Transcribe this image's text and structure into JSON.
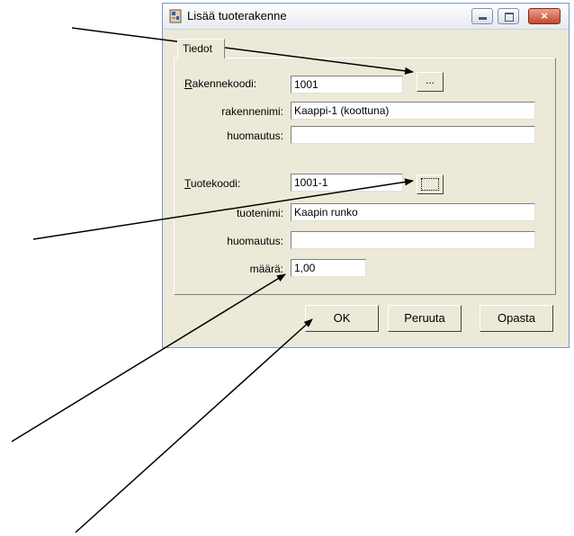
{
  "window": {
    "title": "Lisää tuoterakenne",
    "controls": {
      "minimize": "minimize-icon",
      "maximize": "maximize-icon",
      "close": "×"
    }
  },
  "tabs": [
    {
      "label": "Tiedot",
      "active": true
    }
  ],
  "form": {
    "rakennekoodi": {
      "label": "Rakennekoodi:",
      "value": "1001",
      "browse": "..."
    },
    "rakennenimi": {
      "label": "rakennenimi:",
      "value": "Kaappi-1 (koottuna)"
    },
    "huomautus1": {
      "label": "huomautus:",
      "value": ""
    },
    "tuotekoodi": {
      "label": "Tuotekoodi:",
      "value": "1001-1",
      "browse": "..."
    },
    "tuotenimi": {
      "label": "tuotenimi:",
      "value": "Kaapin runko"
    },
    "huomautus2": {
      "label": "huomautus:",
      "value": ""
    },
    "maara": {
      "label": "määrä:",
      "value": "1,00"
    }
  },
  "buttons": {
    "ok": "OK",
    "cancel": "Peruuta",
    "help": "Opasta"
  },
  "colors": {
    "dialog_bg": "#ece9d8",
    "close_button": "#c7452b",
    "border": "#7a96c8"
  }
}
